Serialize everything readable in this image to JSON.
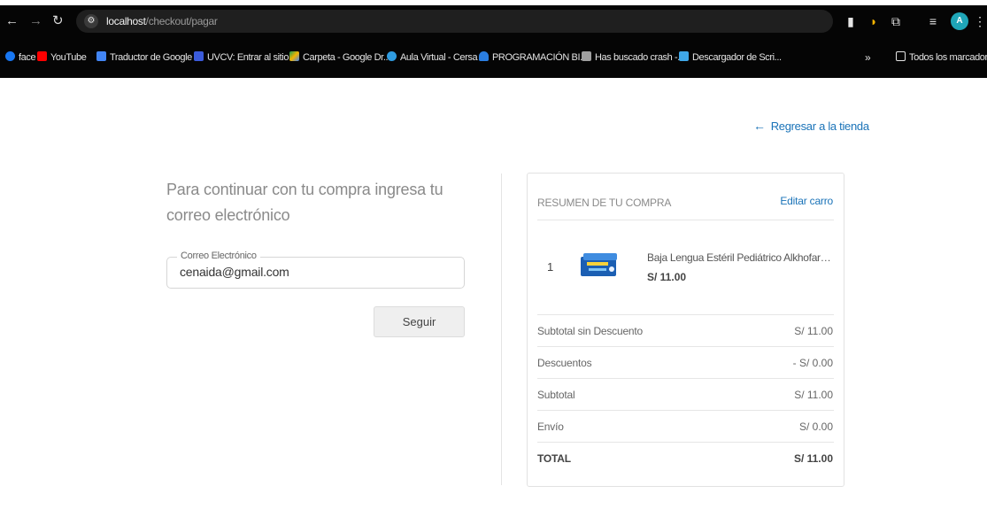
{
  "browser": {
    "url_host": "localhost",
    "url_path": "/checkout/pagar",
    "bookmarks": [
      {
        "label": "face",
        "color": "#1877f2"
      },
      {
        "label": "YouTube",
        "color": "#ff0000"
      },
      {
        "label": "Traductor de Google",
        "color": "#4285f4"
      },
      {
        "label": "UVCV: Entrar al sitio",
        "color": "#3b5bdb"
      },
      {
        "label": "Carpeta - Google Dr...",
        "color": "#f4b400"
      },
      {
        "label": "Aula Virtual - Cersa",
        "color": "#2f9be0"
      },
      {
        "label": "PROGRAMACIÓN BI...",
        "color": "#2a7de1"
      },
      {
        "label": "Has buscado crash -...",
        "color": "#a0a0a0"
      },
      {
        "label": "Descargador de Scri...",
        "color": "#3fa7e8"
      }
    ],
    "more_bookmarks": "»",
    "all_bookmarks": "Todos los marcadores",
    "avatar_letter": "A"
  },
  "page": {
    "back_link": "Regresar a la tienda",
    "prompt": "Para continuar con tu compra ingresa tu correo electrónico",
    "email_label": "Correo Electrónico",
    "email_value": "cenaida@gmail.com",
    "continue_button": "Seguir"
  },
  "summary": {
    "title": "RESUMEN DE TU COMPRA",
    "edit_cart": "Editar carro",
    "item": {
      "qty": "1",
      "name": "Baja Lengua Estéril Pediátrico Alkhofar C...",
      "price": "S/ 11.00"
    },
    "rows": [
      {
        "label": "Subtotal sin Descuento",
        "value": "S/ 11.00"
      },
      {
        "label": "Descuentos",
        "value": "- S/ 0.00"
      },
      {
        "label": "Subtotal",
        "value": "S/ 11.00"
      },
      {
        "label": "Envío",
        "value": "S/ 0.00"
      },
      {
        "label": "TOTAL",
        "value": "S/ 11.00"
      }
    ]
  },
  "colors": {
    "link": "#1a73b8",
    "chrome_bg": "#050505"
  }
}
